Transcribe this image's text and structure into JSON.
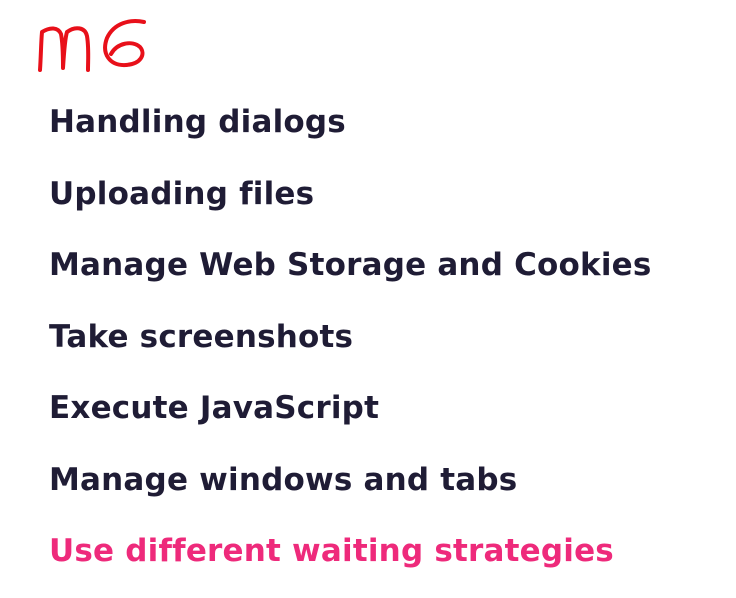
{
  "annotation": {
    "text": "m6",
    "color": "#e8101a"
  },
  "topics": [
    {
      "label": "Handling dialogs",
      "highlighted": false
    },
    {
      "label": "Uploading files",
      "highlighted": false
    },
    {
      "label": "Manage Web Storage and Cookies",
      "highlighted": false
    },
    {
      "label": "Take screenshots",
      "highlighted": false
    },
    {
      "label": "Execute JavaScript",
      "highlighted": false
    },
    {
      "label": "Manage windows and tabs",
      "highlighted": false
    },
    {
      "label": "Use different waiting strategies",
      "highlighted": true
    }
  ],
  "colors": {
    "text": "#1f1c35",
    "highlight": "#ee2a7b",
    "background": "#ffffff"
  }
}
